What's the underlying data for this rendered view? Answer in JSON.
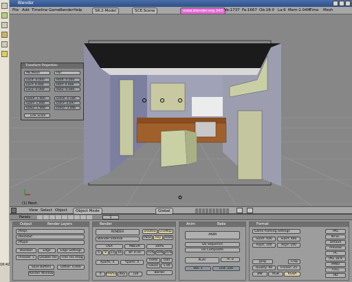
{
  "title": "Blender",
  "menu": {
    "items": [
      "File",
      "Add",
      "Timeline",
      "Game",
      "Render",
      "Help"
    ],
    "screen": "SR:2-Model",
    "scene": "SCE:Scene",
    "url": "www.blender.org 243",
    "stats": [
      "Ve:1737",
      "Fa:1667",
      "Ob:18-0",
      "La:6",
      "Mem:1.04M",
      "Time",
      "Mesh"
    ]
  },
  "transform": {
    "title": "Transform Properties",
    "me": "ME:Mesh",
    "par": "Par:",
    "loc": [
      "LocX: 0.000",
      "LocY: 0.000",
      "LocZ: 0.000"
    ],
    "rot": [
      "RotX: 0.000",
      "RotY: 0.000",
      "RotZ: 0.000"
    ],
    "scale": [
      "SizeX: 1.000",
      "SizeY: 1.000",
      "SizeZ: 1.000"
    ],
    "dim": [
      "DimX: 4.184",
      "DimY: 4.697",
      "DimZ: 3.446"
    ],
    "link": "Link Scale"
  },
  "viewport": {
    "object_label": "(1) Mesh"
  },
  "vp_header": {
    "view": "View",
    "select": "Select",
    "object": "Object",
    "mode": "Object Mode",
    "pivot": "Global",
    "layer": "1"
  },
  "buttons_header": {
    "panels": "Panels",
    "frame": "1"
  },
  "output": {
    "tab1": "Output",
    "tab2": "Render Layers",
    "paths": [
      "//tmp\\",
      "//backbuf",
      "//ftype"
    ],
    "backbuf": "Backbuf",
    "edge": "Edge",
    "edge_settings": "Edge Settings",
    "threads": "Threads: 1",
    "disable_tex": "Disable Tex",
    "free_tex": "Free Tex Imag",
    "save_buffers": "Save Buffers",
    "dither": "Dither: 0.000",
    "render_window": "Render Window"
  },
  "render": {
    "title": "Render",
    "btn": "RENDER",
    "engine": "Blender Internal",
    "shadow": "Shadow",
    "envmap": "EnvMap",
    "pano": "Pano",
    "ray": "Ray",
    "radio": "Radi",
    "osa": "OSA",
    "mblur": "MBLUR",
    "pct100": "100%",
    "osa_vals": [
      "5",
      "8",
      "11",
      "16"
    ],
    "bf": "Bf: 0.50",
    "pcts": [
      "75%",
      "50%",
      "25%"
    ],
    "xparts": "Xparts: 4",
    "yparts": "Yparts: 4",
    "fields": "Fields",
    "odd": "Odd",
    "x": "X",
    "gauss": "Gauss",
    "gauss_val": "1.00",
    "premul": "Premul",
    "key": "Key",
    "val_128": "128",
    "border": "Border"
  },
  "anim": {
    "tab": "Anim",
    "tab2": "Bake",
    "btn": "ANIM",
    "do_seq": "Do Sequence",
    "do_comp": "Do Composite",
    "play": "PLAY",
    "rt": "rt: 0",
    "sta": "Sta: 1",
    "end": "End: 250"
  },
  "format": {
    "title": "Format",
    "preset": "Game framing settings",
    "sizex": "SizeX: 640",
    "sizey": "SizeY: 480",
    "aspx": "AspX: 100",
    "aspy": "AspY: 100",
    "pal": "PAL",
    "ntsc": "NTSC",
    "default": "Default",
    "preview": "Preview",
    "pc": "PC",
    "pal169": "PAL 16:9",
    "pano": "PANO",
    "full": "FULL",
    "hd": "HD",
    "jpeg": "Jpeg",
    "crop": "Crop",
    "quality": "Quality: 90",
    "frs": "Frs/sec: 25",
    "bw": "BW",
    "rgb": "RGB",
    "rgba": "RGBA"
  },
  "osl": {
    "time": "16:42"
  }
}
